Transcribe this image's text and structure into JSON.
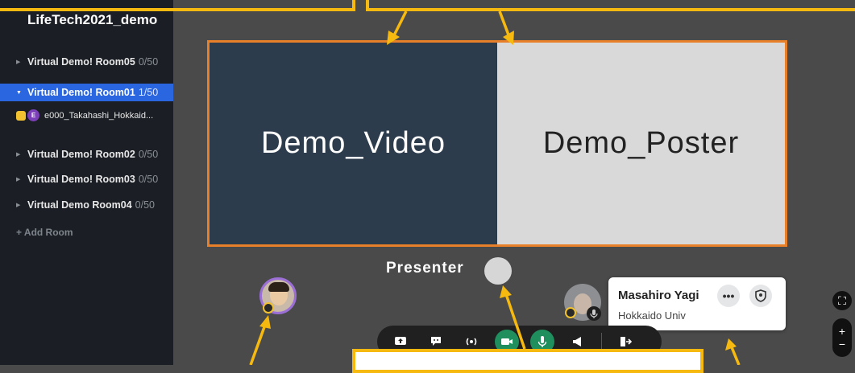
{
  "space": {
    "title": "LifeTech2021_demo"
  },
  "rooms": [
    {
      "name": "Virtual Demo! Room05",
      "count": "0/50"
    },
    {
      "name": "Virtual Demo! Room01",
      "count": "1/50"
    },
    {
      "name": "Virtual Demo! Room02",
      "count": "0/50"
    },
    {
      "name": "Virtual Demo! Room03",
      "count": "0/50"
    },
    {
      "name": "Virtual Demo Room04",
      "count": "0/50"
    }
  ],
  "active_room_member": {
    "initial": "E",
    "name": "e000_Takahashi_Hokkaid..."
  },
  "add_room_label": "+ Add Room",
  "stage": {
    "left_label": "Demo_Video",
    "right_label": "Demo_Poster"
  },
  "presenter_label": "Presenter",
  "profile_card": {
    "name": "Masahiro Yagi",
    "org": "Hokkaido Univ",
    "more": "•••"
  },
  "toolbar": {
    "icons": [
      "share-screen-icon",
      "chat-icon",
      "broadcast-icon",
      "camera-icon",
      "mic-icon",
      "megaphone-icon",
      "exit-icon"
    ]
  },
  "right_controls": {
    "fullscreen": "⛶",
    "zoom_in": "+",
    "zoom_out": "−"
  },
  "colors": {
    "accent_orange": "#e8802a",
    "annotation_yellow": "#f5b90f",
    "active_room": "#2a66e0",
    "mic_green": "#1f8f5e"
  }
}
